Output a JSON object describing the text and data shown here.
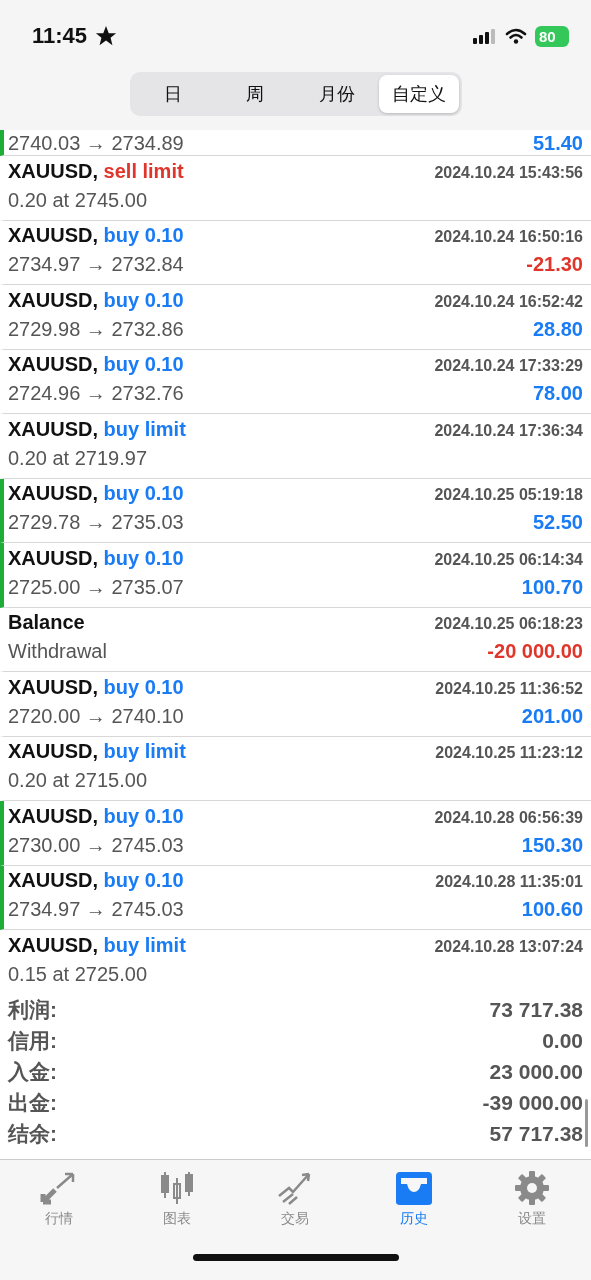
{
  "status_bar": {
    "time": "11:45",
    "battery": "80"
  },
  "period_tabs": [
    {
      "label": "日",
      "selected": false
    },
    {
      "label": "周",
      "selected": false
    },
    {
      "label": "月份",
      "selected": false
    },
    {
      "label": "自定义",
      "selected": true
    }
  ],
  "deals": [
    {
      "kind": "partial",
      "accent": true,
      "detail": "2740.03 → 2734.89",
      "amount": "51.40",
      "loss": false
    },
    {
      "kind": "deal",
      "accent": false,
      "symbol": "XAUUSD,",
      "action": "sell limit",
      "sell": true,
      "time": "2024.10.24 15:43:56",
      "detail": "0.20 at 2745.00"
    },
    {
      "kind": "deal",
      "accent": false,
      "symbol": "XAUUSD,",
      "action": "buy 0.10",
      "sell": false,
      "time": "2024.10.24 16:50:16",
      "detail": "2734.97 → 2732.84",
      "amount": "-21.30",
      "loss": true
    },
    {
      "kind": "deal",
      "accent": false,
      "symbol": "XAUUSD,",
      "action": "buy 0.10",
      "sell": false,
      "time": "2024.10.24 16:52:42",
      "detail": "2729.98 → 2732.86",
      "amount": "28.80",
      "loss": false
    },
    {
      "kind": "deal",
      "accent": false,
      "symbol": "XAUUSD,",
      "action": "buy 0.10",
      "sell": false,
      "time": "2024.10.24 17:33:29",
      "detail": "2724.96 → 2732.76",
      "amount": "78.00",
      "loss": false
    },
    {
      "kind": "deal",
      "accent": false,
      "symbol": "XAUUSD,",
      "action": "buy limit",
      "sell": false,
      "time": "2024.10.24 17:36:34",
      "detail": "0.20 at 2719.97"
    },
    {
      "kind": "deal",
      "accent": true,
      "symbol": "XAUUSD,",
      "action": "buy 0.10",
      "sell": false,
      "time": "2024.10.25 05:19:18",
      "detail": "2729.78 → 2735.03",
      "amount": "52.50",
      "loss": false
    },
    {
      "kind": "deal",
      "accent": true,
      "symbol": "XAUUSD,",
      "action": "buy 0.10",
      "sell": false,
      "time": "2024.10.25 06:14:34",
      "detail": "2725.00 → 2735.07",
      "amount": "100.70",
      "loss": false
    },
    {
      "kind": "balance",
      "accent": false,
      "symbol": "Balance",
      "time": "2024.10.25 06:18:23",
      "detail": "Withdrawal",
      "amount": "-20 000.00",
      "loss": true
    },
    {
      "kind": "deal",
      "accent": false,
      "symbol": "XAUUSD,",
      "action": "buy 0.10",
      "sell": false,
      "time": "2024.10.25 11:36:52",
      "detail": "2720.00 → 2740.10",
      "amount": "201.00",
      "loss": false
    },
    {
      "kind": "deal",
      "accent": false,
      "symbol": "XAUUSD,",
      "action": "buy limit",
      "sell": false,
      "time": "2024.10.25 11:23:12",
      "detail": "0.20 at 2715.00"
    },
    {
      "kind": "deal",
      "accent": true,
      "symbol": "XAUUSD,",
      "action": "buy 0.10",
      "sell": false,
      "time": "2024.10.28 06:56:39",
      "detail": "2730.00 → 2745.03",
      "amount": "150.30",
      "loss": false
    },
    {
      "kind": "deal",
      "accent": true,
      "symbol": "XAUUSD,",
      "action": "buy 0.10",
      "sell": false,
      "time": "2024.10.28 11:35:01",
      "detail": "2734.97 → 2745.03",
      "amount": "100.60",
      "loss": false
    },
    {
      "kind": "deal",
      "accent": false,
      "symbol": "XAUUSD,",
      "action": "buy limit",
      "sell": false,
      "time": "2024.10.28 13:07:24",
      "detail": "0.15 at 2725.00"
    }
  ],
  "summary": [
    {
      "label": "利润:",
      "value": "73 717.38"
    },
    {
      "label": "信用:",
      "value": "0.00"
    },
    {
      "label": "入金:",
      "value": "23 000.00"
    },
    {
      "label": "出金:",
      "value": "-39 000.00"
    },
    {
      "label": "结余:",
      "value": "57 717.38"
    }
  ],
  "tab_bar": [
    {
      "kind": "quotes",
      "label": "行情",
      "selected": false
    },
    {
      "kind": "chart",
      "label": "图表",
      "selected": false
    },
    {
      "kind": "trade",
      "label": "交易",
      "selected": false
    },
    {
      "kind": "history",
      "label": "历史",
      "selected": true
    },
    {
      "kind": "settings",
      "label": "设置",
      "selected": false
    }
  ]
}
